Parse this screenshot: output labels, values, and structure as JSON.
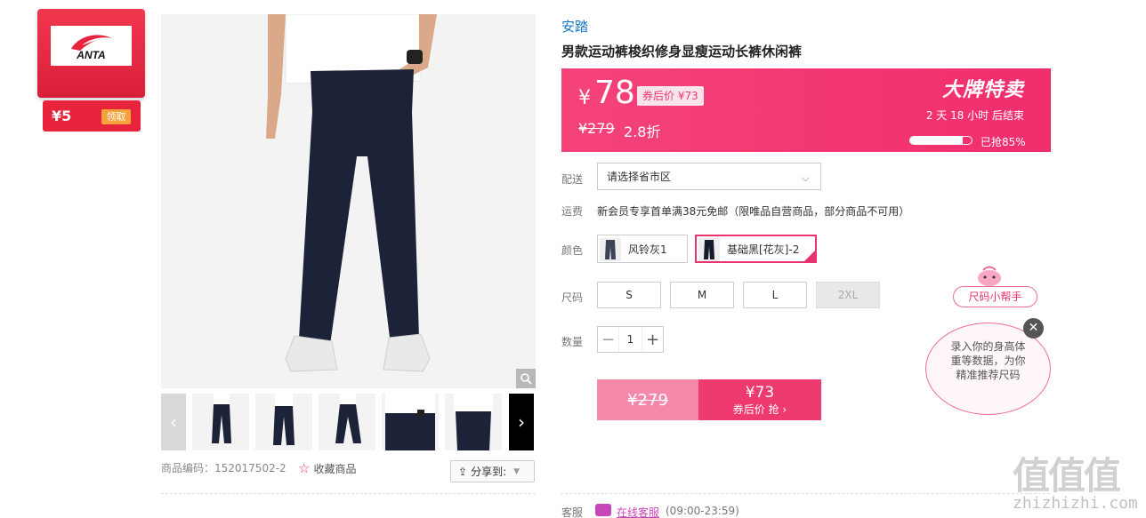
{
  "brand_card": {
    "logo_text": "ANTA",
    "coupon_amount": "¥5",
    "coupon_button": "领取"
  },
  "product": {
    "brand": "安踏",
    "title": "男款运动裤梭织修身显瘦运动长裤休闲裤",
    "code_label": "商品编码：152017502-2",
    "favorite_label": "收藏商品",
    "share_label": "分享到:"
  },
  "price_box": {
    "currency": "¥",
    "price": "78",
    "coupon_price": "券后价 ¥73",
    "original_price": "¥279",
    "discount": "2.8折",
    "sale_title": "大牌特卖",
    "countdown": "2  天  18  小时  后结束",
    "progress_fraction": 0.85,
    "progress_text": "已抢85%"
  },
  "delivery": {
    "label": "配送",
    "placeholder": "请选择省市区"
  },
  "shipping": {
    "label": "运费",
    "text": "新会员专享首单满38元免邮（限唯品自营商品，部分商品不可用）"
  },
  "colors": {
    "label": "颜色",
    "options": [
      "风铃灰1",
      "基础黑[花灰]-2"
    ],
    "selected": 1
  },
  "sizes": {
    "label": "尺码",
    "options": [
      "S",
      "M",
      "L",
      "2XL"
    ],
    "disabled": [
      "2XL"
    ]
  },
  "quantity": {
    "label": "数量",
    "value": "1",
    "minus": "−",
    "plus": "+"
  },
  "buy": {
    "original": "¥279",
    "price": "¥73",
    "action": "券后价 抢 ›"
  },
  "size_helper": {
    "tag": "尺码小帮手",
    "bubble": "录入你的身高体重等数据，为你精准推荐尺码",
    "close": "✕"
  },
  "service": {
    "label": "客服",
    "link": "在线客服",
    "hours": "(09:00-23:59)"
  },
  "watermark": {
    "text": "值值值",
    "url": "zhizhizhi.com"
  },
  "colors_theme": {
    "accent": "#ee3a6e",
    "brand_blue": "#1577c9",
    "brand_red": "#e8243c"
  }
}
